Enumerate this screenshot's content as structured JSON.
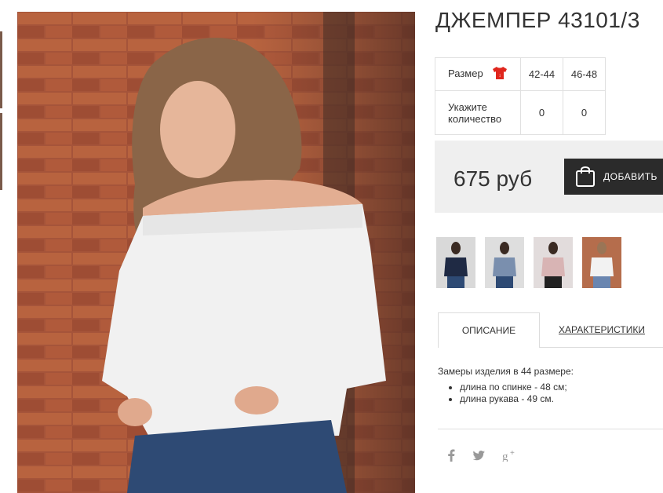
{
  "product": {
    "title": "ДЖЕМПЕР 43101/3",
    "price": "675 руб",
    "cart_label": "ДОБАВИТЬ"
  },
  "sizes_table": {
    "row_size_label": "Размер",
    "row_qty_label_line1": "Укажите",
    "row_qty_label_line2": "количество",
    "sizes": [
      "42-44",
      "46-48"
    ],
    "quantities": [
      "0",
      "0"
    ]
  },
  "tabs": {
    "description": "ОПИСАНИЕ",
    "characteristics": "ХАРАКТЕРИСТИКИ"
  },
  "description": {
    "intro": "Замеры изделия в 44 размере:",
    "items": [
      "длина по спинке - 48 см;",
      "длина рукава - 49 см."
    ]
  },
  "color_variants": [
    "navy",
    "blue-grey",
    "pink",
    "white"
  ],
  "colors": {
    "accent": "#2b2b2b",
    "price_bg": "#efefef",
    "icon_red": "#e0261d"
  },
  "social": {
    "facebook": "f",
    "twitter": "twitter-bird",
    "googleplus": "g+"
  }
}
